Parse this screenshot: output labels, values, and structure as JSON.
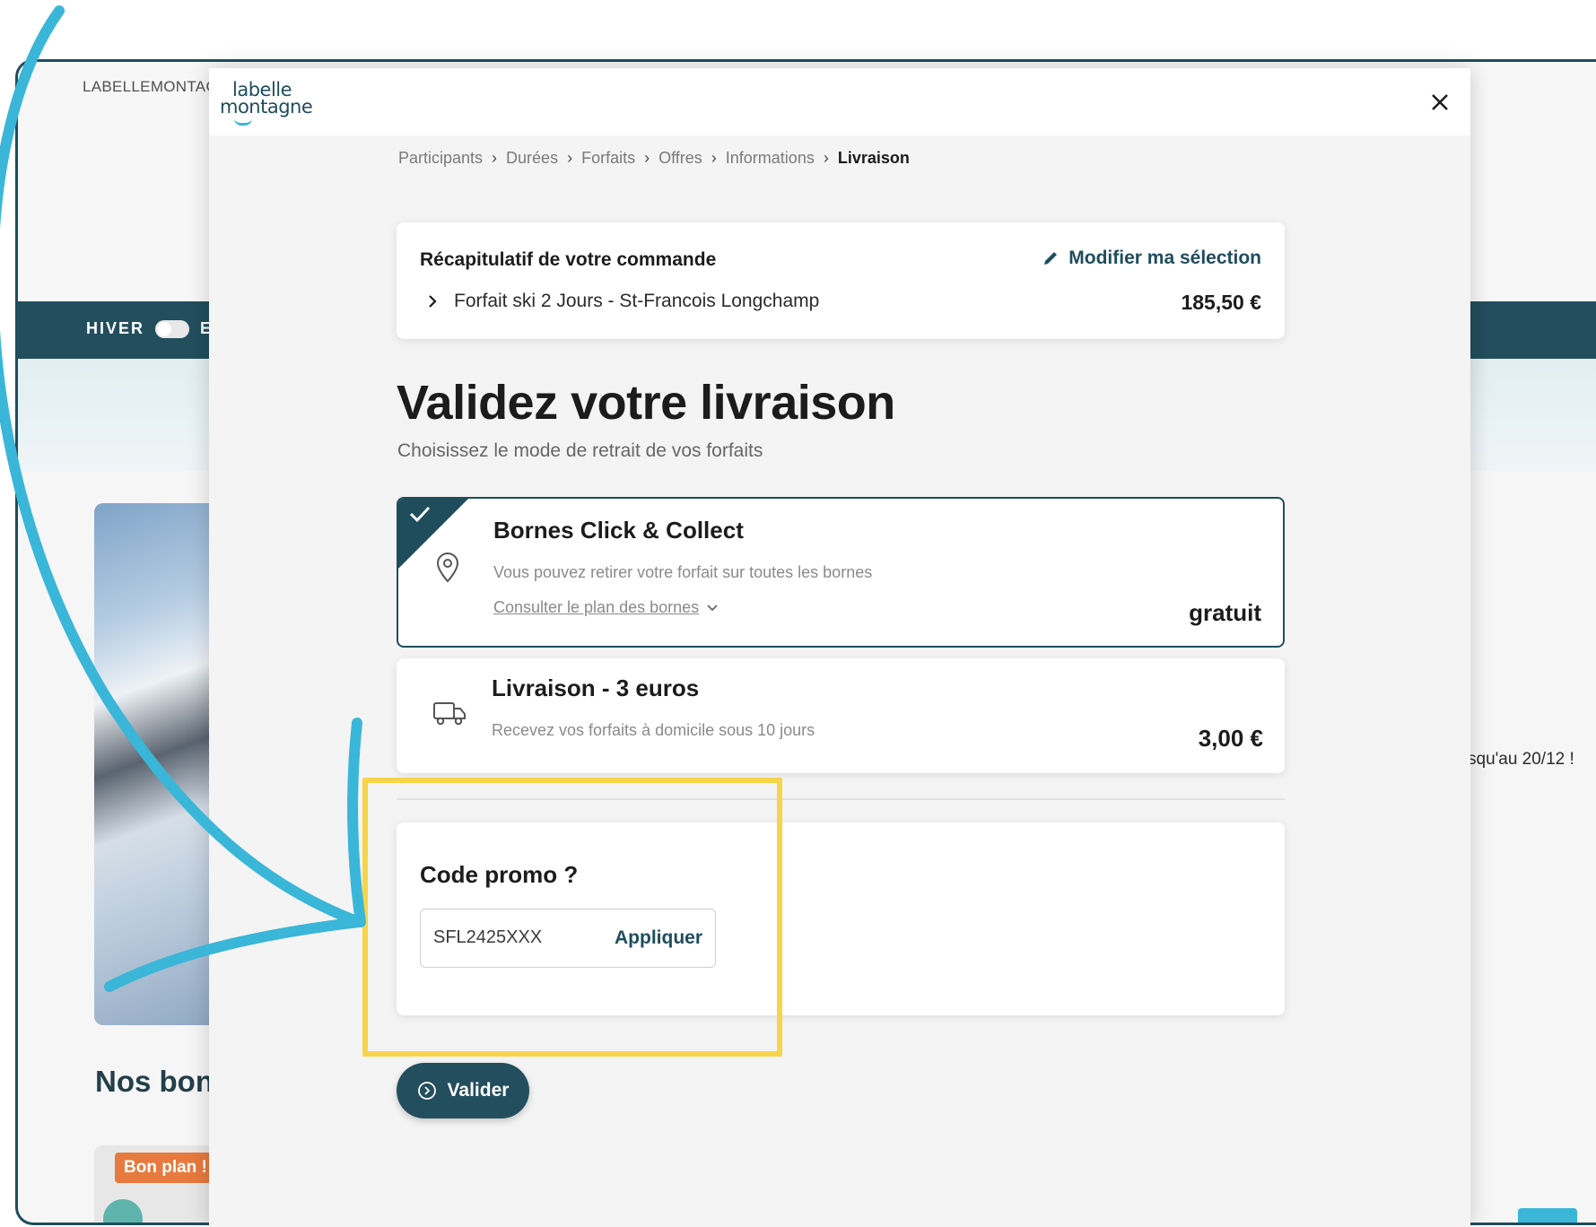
{
  "background": {
    "site_name": "LABELLEMONTAG",
    "season_label": "HIVER",
    "season_next_letter": "E",
    "section_heading": "Nos bon",
    "badge": "Bon plan !",
    "right_text": "squ'au 20/12 !"
  },
  "modal": {
    "logo": {
      "line1": "labelle",
      "line2": "montagne"
    },
    "close_icon": "close-icon",
    "breadcrumb": [
      "Participants",
      "Durées",
      "Forfaits",
      "Offres",
      "Informations"
    ],
    "breadcrumb_current": "Livraison",
    "summary": {
      "title": "Récapitulatif de votre commande",
      "modify_label": "Modifier ma sélection",
      "item": "Forfait ski 2 Jours - St-Francois Longchamp",
      "price": "185,50 €"
    },
    "title": "Validez votre livraison",
    "subtitle": "Choisissez le mode de retrait de vos forfaits",
    "options": [
      {
        "title": "Bornes Click & Collect",
        "description": "Vous pouvez retirer votre forfait sur toutes les bornes",
        "link": "Consulter le plan des bornes",
        "price": "gratuit",
        "icon": "location-pin-icon",
        "selected": true
      },
      {
        "title": "Livraison - 3 euros",
        "description": "Recevez vos forfaits à domicile sous 10 jours",
        "price": "3,00 €",
        "icon": "truck-icon",
        "selected": false
      }
    ],
    "promo": {
      "title": "Code promo ?",
      "value": "SFL2425XXX",
      "apply_label": "Appliquer"
    },
    "validate_label": "Valider"
  },
  "colors": {
    "primary": "#1f4d5c",
    "highlight": "#f7d54a",
    "arrow": "#3ab6d8",
    "badge": "#e77a3e"
  }
}
